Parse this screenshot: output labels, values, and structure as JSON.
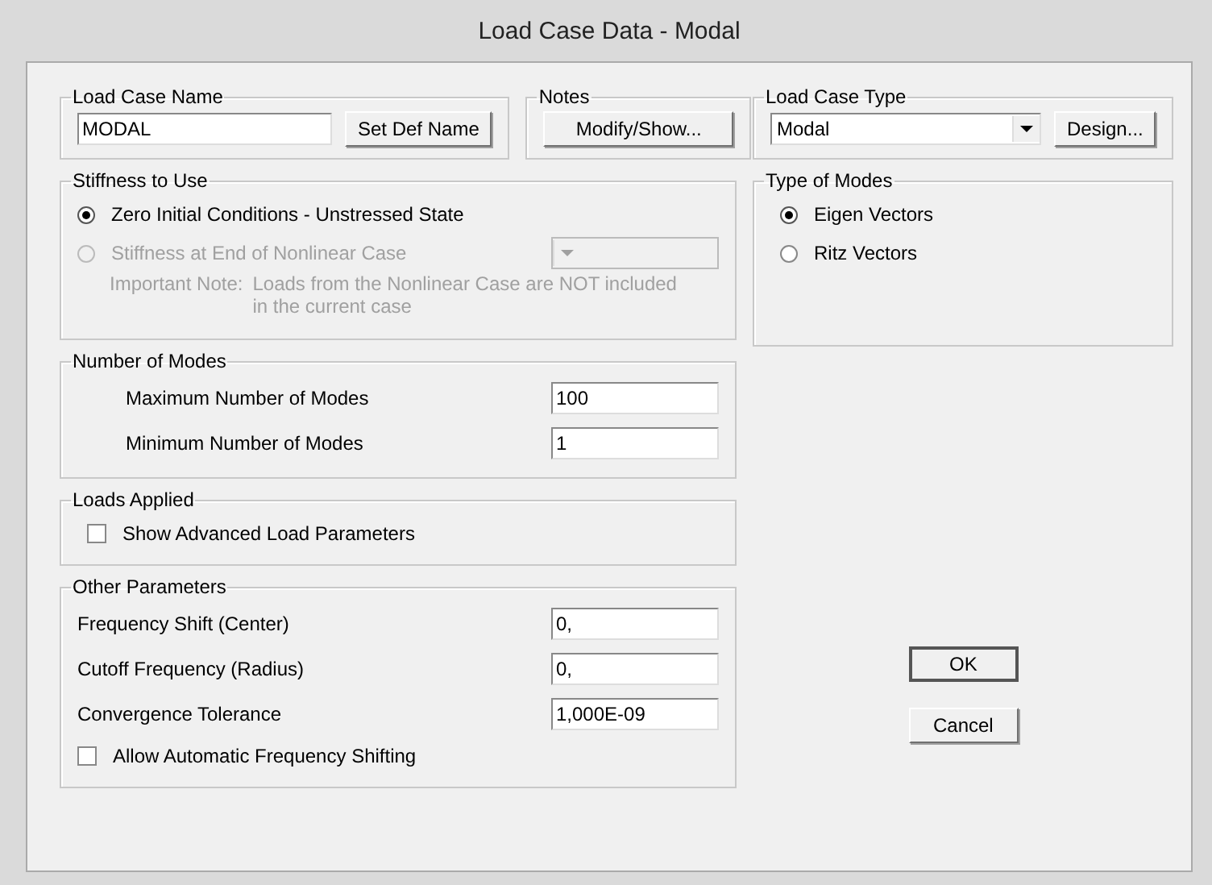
{
  "window": {
    "title": "Load Case Data - Modal"
  },
  "load_case_name": {
    "title": "Load Case Name",
    "value": "MODAL",
    "button": "Set Def Name"
  },
  "notes": {
    "title": "Notes",
    "button": "Modify/Show..."
  },
  "load_case_type": {
    "title": "Load Case Type",
    "value": "Modal",
    "button": "Design..."
  },
  "stiffness": {
    "title": "Stiffness to Use",
    "options": [
      {
        "label": "Zero Initial Conditions - Unstressed State",
        "selected": true,
        "disabled": false
      },
      {
        "label": "Stiffness at End of Nonlinear Case",
        "selected": false,
        "disabled": true
      }
    ],
    "combo": {
      "disabled": true
    },
    "note_label": "Important Note:",
    "note_text": "Loads from the Nonlinear Case are NOT included in the current case"
  },
  "type_of_modes": {
    "title": "Type of Modes",
    "options": [
      {
        "label": "Eigen Vectors",
        "selected": true
      },
      {
        "label": "Ritz Vectors",
        "selected": false
      }
    ]
  },
  "number_of_modes": {
    "title": "Number of Modes",
    "fields": [
      {
        "label": "Maximum Number of Modes",
        "value": "100"
      },
      {
        "label": "Minimum Number of Modes",
        "value": "1"
      }
    ]
  },
  "loads_applied": {
    "title": "Loads Applied",
    "checkboxes": [
      {
        "label": "Show Advanced Load Parameters",
        "checked": false
      }
    ]
  },
  "other_parameters": {
    "title": "Other Parameters",
    "fields": [
      {
        "label": "Frequency Shift (Center)",
        "value": "0,"
      },
      {
        "label": "Cutoff Frequency (Radius)",
        "value": "0,"
      },
      {
        "label": "Convergence Tolerance",
        "value": "1,000E-09"
      }
    ],
    "checkboxes": [
      {
        "label": "Allow Automatic Frequency Shifting",
        "checked": false
      }
    ]
  },
  "buttons": [
    {
      "label": "OK",
      "default": true
    },
    {
      "label": "Cancel",
      "default": false
    }
  ]
}
